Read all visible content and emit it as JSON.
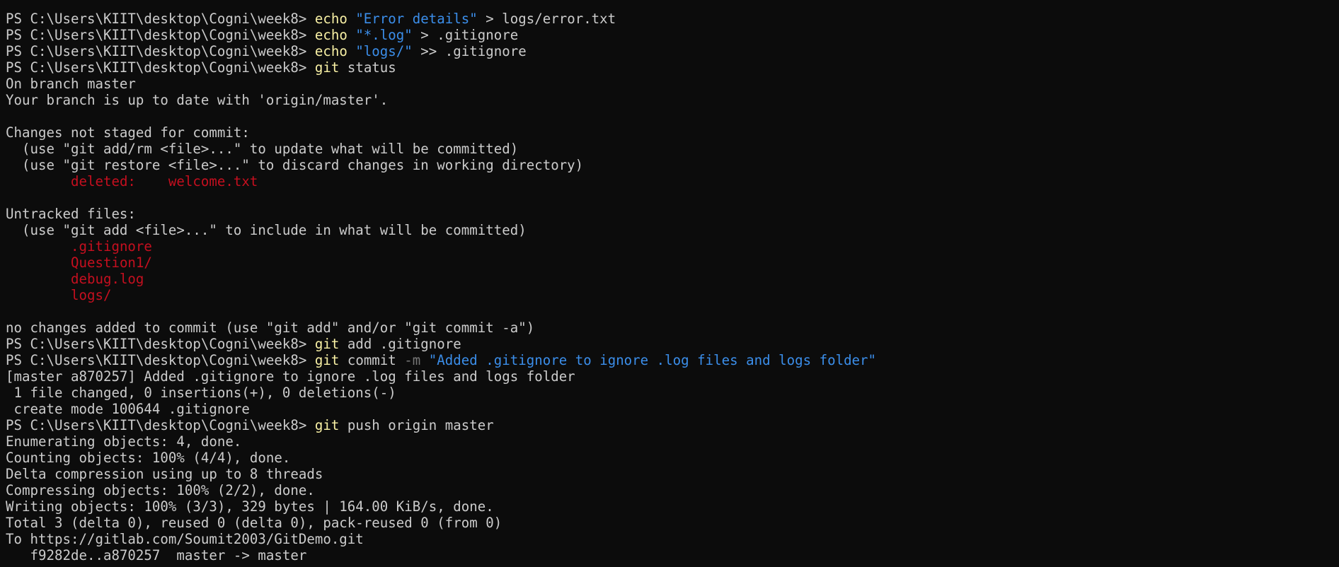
{
  "terminal": {
    "colors": {
      "background": "#0c0c0c",
      "foreground": "#cccccc",
      "command": "#f9f1a5",
      "string": "#3b8eea",
      "parameter": "#767676",
      "git_status_red": "#c50f1f"
    },
    "lines": [
      [
        {
          "t": "PS C:\\Users\\KIIT\\desktop\\Cogni\\week8> ",
          "c": "prompt"
        },
        {
          "t": "echo",
          "c": "cmd"
        },
        {
          "t": " ",
          "c": "arg"
        },
        {
          "t": "\"Error details\"",
          "c": "str"
        },
        {
          "t": " > logs/error.txt",
          "c": "arg"
        }
      ],
      [
        {
          "t": "PS C:\\Users\\KIIT\\desktop\\Cogni\\week8> ",
          "c": "prompt"
        },
        {
          "t": "echo",
          "c": "cmd"
        },
        {
          "t": " ",
          "c": "arg"
        },
        {
          "t": "\"*.log\"",
          "c": "str"
        },
        {
          "t": " > .gitignore",
          "c": "arg"
        }
      ],
      [
        {
          "t": "PS C:\\Users\\KIIT\\desktop\\Cogni\\week8> ",
          "c": "prompt"
        },
        {
          "t": "echo",
          "c": "cmd"
        },
        {
          "t": " ",
          "c": "arg"
        },
        {
          "t": "\"logs/\"",
          "c": "str"
        },
        {
          "t": " >> .gitignore",
          "c": "arg"
        }
      ],
      [
        {
          "t": "PS C:\\Users\\KIIT\\desktop\\Cogni\\week8> ",
          "c": "prompt"
        },
        {
          "t": "git",
          "c": "cmd"
        },
        {
          "t": " status",
          "c": "arg"
        }
      ],
      [
        {
          "t": "On branch master",
          "c": "out"
        }
      ],
      [
        {
          "t": "Your branch is up to date with 'origin/master'.",
          "c": "out"
        }
      ],
      [],
      [
        {
          "t": "Changes not staged for commit:",
          "c": "out"
        }
      ],
      [
        {
          "t": "  (use \"git add/rm <file>...\" to update what will be committed)",
          "c": "out"
        }
      ],
      [
        {
          "t": "  (use \"git restore <file>...\" to discard changes in working directory)",
          "c": "out"
        }
      ],
      [
        {
          "t": "        ",
          "c": "out"
        },
        {
          "t": "deleted:    welcome.txt",
          "c": "red"
        }
      ],
      [],
      [
        {
          "t": "Untracked files:",
          "c": "out"
        }
      ],
      [
        {
          "t": "  (use \"git add <file>...\" to include in what will be committed)",
          "c": "out"
        }
      ],
      [
        {
          "t": "        ",
          "c": "out"
        },
        {
          "t": ".gitignore",
          "c": "red"
        }
      ],
      [
        {
          "t": "        ",
          "c": "out"
        },
        {
          "t": "Question1/",
          "c": "red"
        }
      ],
      [
        {
          "t": "        ",
          "c": "out"
        },
        {
          "t": "debug.log",
          "c": "red"
        }
      ],
      [
        {
          "t": "        ",
          "c": "out"
        },
        {
          "t": "logs/",
          "c": "red"
        }
      ],
      [],
      [
        {
          "t": "no changes added to commit (use \"git add\" and/or \"git commit -a\")",
          "c": "out"
        }
      ],
      [
        {
          "t": "PS C:\\Users\\KIIT\\desktop\\Cogni\\week8> ",
          "c": "prompt"
        },
        {
          "t": "git",
          "c": "cmd"
        },
        {
          "t": " add .gitignore",
          "c": "arg"
        }
      ],
      [
        {
          "t": "PS C:\\Users\\KIIT\\desktop\\Cogni\\week8> ",
          "c": "prompt"
        },
        {
          "t": "git",
          "c": "cmd"
        },
        {
          "t": " commit ",
          "c": "arg"
        },
        {
          "t": "-m",
          "c": "flag"
        },
        {
          "t": " ",
          "c": "arg"
        },
        {
          "t": "\"Added .gitignore to ignore .log files and logs folder\"",
          "c": "str"
        }
      ],
      [
        {
          "t": "[master a870257] Added .gitignore to ignore .log files and logs folder",
          "c": "out"
        }
      ],
      [
        {
          "t": " 1 file changed, 0 insertions(+), 0 deletions(-)",
          "c": "out"
        }
      ],
      [
        {
          "t": " create mode 100644 .gitignore",
          "c": "out"
        }
      ],
      [
        {
          "t": "PS C:\\Users\\KIIT\\desktop\\Cogni\\week8> ",
          "c": "prompt"
        },
        {
          "t": "git",
          "c": "cmd"
        },
        {
          "t": " push origin master",
          "c": "arg"
        }
      ],
      [
        {
          "t": "Enumerating objects: 4, done.",
          "c": "out"
        }
      ],
      [
        {
          "t": "Counting objects: 100% (4/4), done.",
          "c": "out"
        }
      ],
      [
        {
          "t": "Delta compression using up to 8 threads",
          "c": "out"
        }
      ],
      [
        {
          "t": "Compressing objects: 100% (2/2), done.",
          "c": "out"
        }
      ],
      [
        {
          "t": "Writing objects: 100% (3/3), 329 bytes | 164.00 KiB/s, done.",
          "c": "out"
        }
      ],
      [
        {
          "t": "Total 3 (delta 0), reused 0 (delta 0), pack-reused 0 (from 0)",
          "c": "out"
        }
      ],
      [
        {
          "t": "To https://gitlab.com/Soumit2003/GitDemo.git",
          "c": "out"
        }
      ],
      [
        {
          "t": "   f9282de..a870257  master -> master",
          "c": "out"
        }
      ]
    ]
  }
}
